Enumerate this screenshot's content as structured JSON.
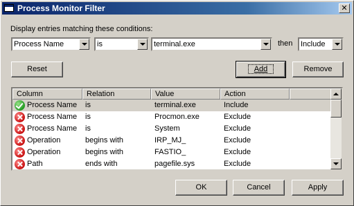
{
  "window": {
    "title": "Process Monitor Filter",
    "close_glyph": "✕"
  },
  "conditions": {
    "prompt": "Display entries matching these conditions:",
    "column": "Process Name",
    "relation": "is",
    "value": "terminal.exe",
    "then_label": "then",
    "action": "Include"
  },
  "buttons": {
    "reset": "Reset",
    "add": "Add",
    "remove": "Remove",
    "ok": "OK",
    "cancel": "Cancel",
    "apply": "Apply"
  },
  "table": {
    "headers": [
      "Column",
      "Relation",
      "Value",
      "Action"
    ],
    "rows": [
      {
        "icon": "check-icon",
        "column": "Process Name",
        "relation": "is",
        "value": "terminal.exe",
        "action": "Include"
      },
      {
        "icon": "exclude-icon",
        "column": "Process Name",
        "relation": "is",
        "value": "Procmon.exe",
        "action": "Exclude"
      },
      {
        "icon": "exclude-icon",
        "column": "Process Name",
        "relation": "is",
        "value": "System",
        "action": "Exclude"
      },
      {
        "icon": "exclude-icon",
        "column": "Operation",
        "relation": "begins with",
        "value": "IRP_MJ_",
        "action": "Exclude"
      },
      {
        "icon": "exclude-icon",
        "column": "Operation",
        "relation": "begins with",
        "value": "FASTIO_",
        "action": "Exclude"
      },
      {
        "icon": "exclude-icon",
        "column": "Path",
        "relation": "ends with",
        "value": "pagefile.sys",
        "action": "Exclude"
      }
    ]
  },
  "colors": {
    "titlebar_start": "#0a246a",
    "titlebar_end": "#a6caf0",
    "face": "#d4d0c8",
    "include": "#1f9a1f",
    "exclude": "#c81010"
  }
}
